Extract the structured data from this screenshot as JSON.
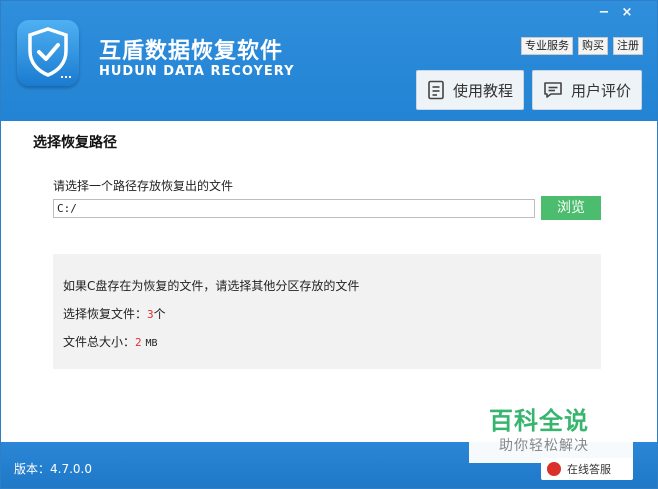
{
  "window": {
    "minimize_symbol": "−",
    "close_symbol": "×"
  },
  "header": {
    "title_cn": "互盾数据恢复软件",
    "title_en": "HUDUN DATA RECOYERY",
    "top_links": [
      "专业服务",
      "购买",
      "注册"
    ],
    "tutorial_label": "使用教程",
    "review_label": "用户评价",
    "brand_color": "#2383d4"
  },
  "main": {
    "section_title": "选择恢复路径",
    "prompt": "请选择一个路径存放恢复出的文件",
    "path_value": "C:/",
    "browse_label": "浏览",
    "info": {
      "warning": "如果C盘存在为恢复的文件，请选择其他分区存放的文件",
      "selected_label": "选择恢复文件：",
      "selected_count": "3",
      "selected_unit": "个",
      "size_label": "文件总大小：",
      "size_value": "2",
      "size_unit": "MB"
    }
  },
  "footer": {
    "version_text": "版本：4.7.0.0"
  },
  "watermark": {
    "main": "百科全说",
    "sub": "助你轻松解决",
    "badge": "在线答服"
  }
}
